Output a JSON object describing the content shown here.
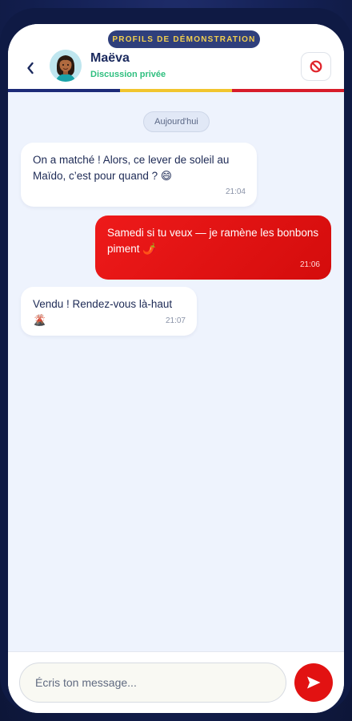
{
  "header": {
    "demo_label": "PROFILS DE DÉMONSTRATION",
    "back_icon": "chevron-left-icon",
    "contact_name": "Maëva",
    "contact_status": "Discussion privée",
    "block_icon": "no-entry-icon"
  },
  "colors": {
    "accent_red": "#e21212",
    "navy": "#1b2a5e",
    "status_green": "#2fbf7f",
    "stripe_blue": "#1c2a78",
    "stripe_yellow": "#f1c52e",
    "stripe_red": "#d71c2a"
  },
  "chat": {
    "day_label": "Aujourd'hui",
    "messages": [
      {
        "direction": "incoming",
        "text": "On a matché ! Alors, ce lever de soleil au Maïdo, c’est pour quand ? 😄",
        "time": "21:04"
      },
      {
        "direction": "outgoing",
        "text": "Samedi si tu veux — je ramène les bonbons piment 🌶️",
        "time": "21:06"
      },
      {
        "direction": "incoming",
        "text": "Vendu ! Rendez-vous là-haut 🌋",
        "time": "21:07"
      }
    ]
  },
  "composer": {
    "placeholder": "Écris ton message...",
    "send_icon": "send-icon"
  }
}
